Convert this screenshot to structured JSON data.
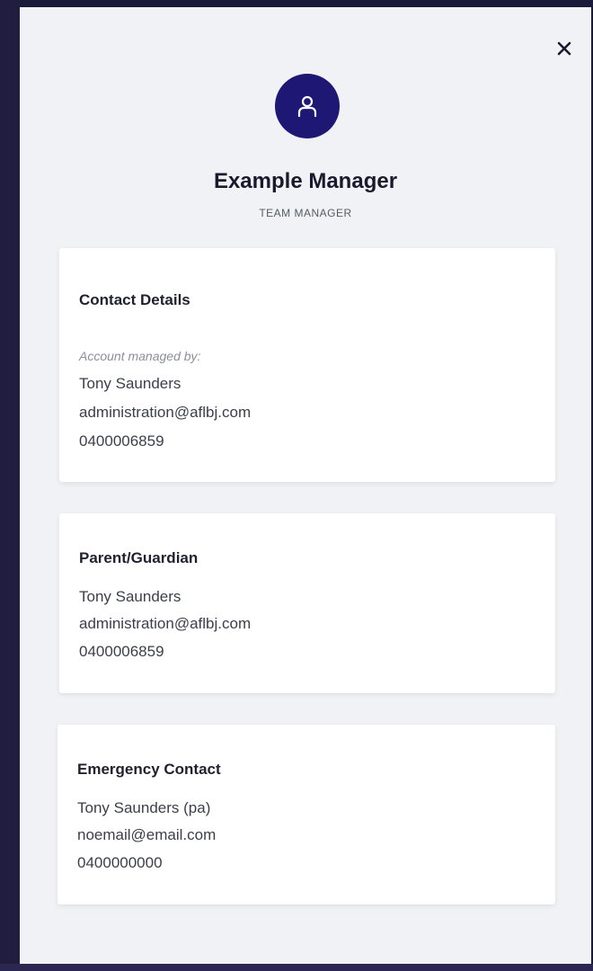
{
  "modal": {
    "close_label": "×",
    "avatar_icon": "user-icon",
    "name": "Example Manager",
    "role": "TEAM MANAGER"
  },
  "cards": {
    "contact": {
      "title": "Contact Details",
      "managed_by_label": "Account managed by:",
      "name": "Tony Saunders",
      "email": "administration@aflbj.com",
      "phone": "0400006859"
    },
    "guardian": {
      "title": "Parent/Guardian",
      "name": "Tony Saunders",
      "email": "administration@aflbj.com",
      "phone": "0400006859"
    },
    "emergency": {
      "title": "Emergency Contact",
      "name": "Tony Saunders (pa)",
      "email": "noemail@email.com",
      "phone": "0400000000"
    }
  },
  "colors": {
    "accent": "#1e1773",
    "panel_bg": "#f1f2f5",
    "card_bg": "#ffffff",
    "backdrop": "#1c1a3a"
  }
}
